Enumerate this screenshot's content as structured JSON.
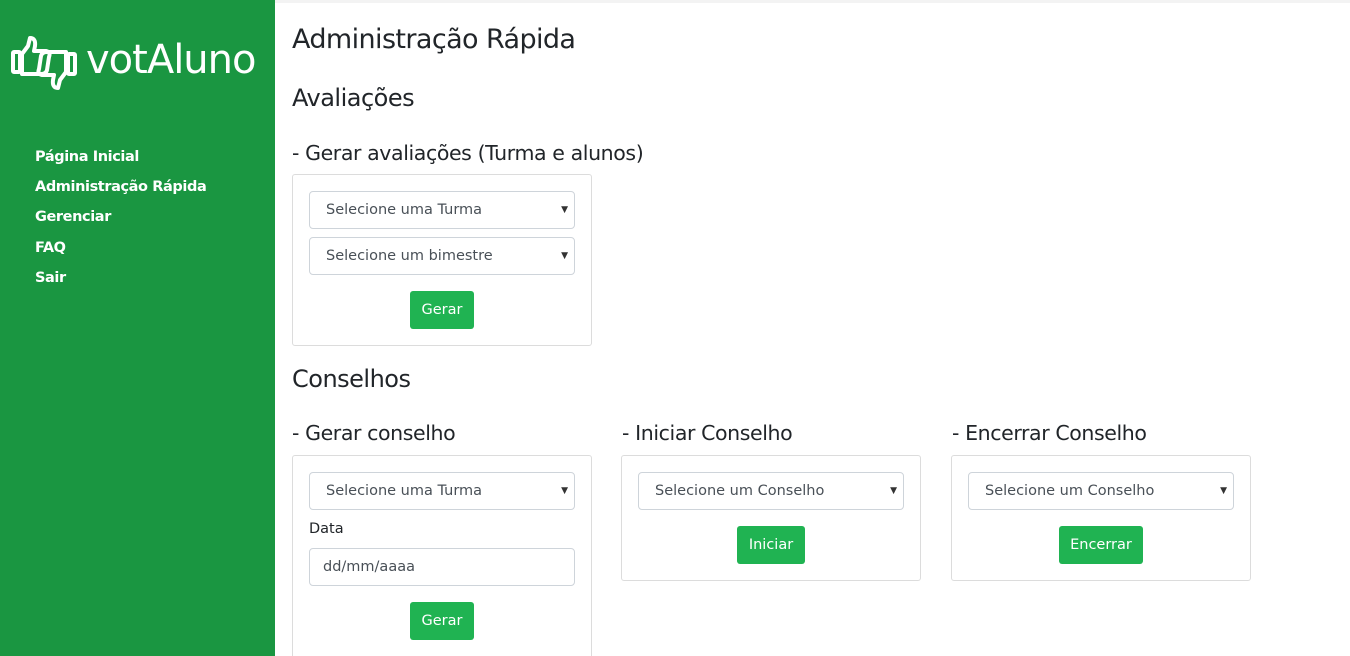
{
  "brand": {
    "name": "votAluno"
  },
  "sidebar": {
    "items": [
      {
        "label": "Página Inicial"
      },
      {
        "label": "Administração Rápida"
      },
      {
        "label": "Gerenciar"
      },
      {
        "label": "FAQ"
      },
      {
        "label": "Sair"
      }
    ]
  },
  "page": {
    "title": "Administração Rápida"
  },
  "avaliacoes": {
    "heading": "Avaliações",
    "gerar": {
      "heading": "- Gerar avaliações (Turma e alunos)",
      "turma_select": "Selecione uma Turma",
      "bimestre_select": "Selecione um bimestre",
      "button": "Gerar"
    }
  },
  "conselhos": {
    "heading": "Conselhos",
    "gerar": {
      "heading": "- Gerar conselho",
      "turma_select": "Selecione uma Turma",
      "data_label": "Data",
      "data_placeholder": "dd/mm/aaaa",
      "button": "Gerar"
    },
    "iniciar": {
      "heading": "- Iniciar Conselho",
      "conselho_select": "Selecione um Conselho",
      "button": "Iniciar"
    },
    "encerrar": {
      "heading": "- Encerrar Conselho",
      "conselho_select": "Selecione um Conselho",
      "button": "Encerrar"
    }
  },
  "colors": {
    "sidebar": "#1a9641",
    "button": "#20b352"
  },
  "icons": {
    "logo": "thumbs-up-down-icon",
    "caret": "caret-down-icon"
  }
}
